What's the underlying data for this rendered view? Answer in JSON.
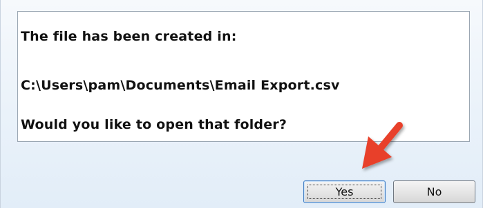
{
  "message": {
    "line1": "The file has been created in:",
    "line2": "C:\\Users\\pam\\Documents\\Email Export.csv",
    "line3": "Would you like to open that folder?"
  },
  "buttons": {
    "yes_label": "Yes",
    "no_label": "No"
  },
  "annotation": {
    "icon": "red-arrow-icon",
    "color": "#e8412c"
  },
  "colors": {
    "dialog_background": "#eaf2fa",
    "panel_border": "#9aa6b2",
    "default_button_border": "#3d7bc3"
  }
}
